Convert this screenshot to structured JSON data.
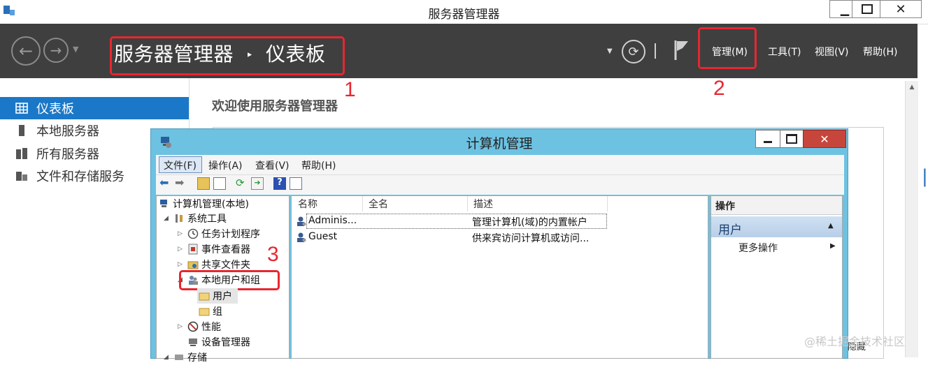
{
  "server_manager": {
    "title": "服务器管理器",
    "breadcrumb_root": "服务器管理器",
    "breadcrumb_sep": "‣",
    "breadcrumb_current": "仪表板",
    "menu": {
      "manage": "管理(M)",
      "tools": "工具(T)",
      "view": "视图(V)",
      "help": "帮助(H)"
    },
    "sidebar": [
      {
        "label": "仪表板"
      },
      {
        "label": "本地服务器"
      },
      {
        "label": "所有服务器"
      },
      {
        "label": "文件和存储服务"
      }
    ],
    "welcome": "欢迎使用服务器管理器"
  },
  "annotations": {
    "one": "1",
    "two": "2",
    "three": "3",
    "color": "#e8262f"
  },
  "computer_management": {
    "title": "计算机管理",
    "menu": [
      "文件(F)",
      "操作(A)",
      "查看(V)",
      "帮助(H)"
    ],
    "tree": [
      {
        "label": "计算机管理(本地)"
      },
      {
        "label": "系统工具"
      },
      {
        "label": "任务计划程序"
      },
      {
        "label": "事件查看器"
      },
      {
        "label": "共享文件夹"
      },
      {
        "label": "本地用户和组"
      },
      {
        "label": "用户"
      },
      {
        "label": "组"
      },
      {
        "label": "性能"
      },
      {
        "label": "设备管理器"
      },
      {
        "label": "存储"
      }
    ],
    "columns": [
      "名称",
      "全名",
      "描述"
    ],
    "rows": [
      {
        "name": "Adminis...",
        "full_name": "",
        "description": "管理计算机(域)的内置帐户"
      },
      {
        "name": "Guest",
        "full_name": "",
        "description": "供来宾访问计算机或访问..."
      }
    ],
    "actions": {
      "header": "操作",
      "section": "用户",
      "more": "更多操作"
    }
  },
  "watermark": "@稀土掘金技术社区",
  "partial_text": "隐藏"
}
